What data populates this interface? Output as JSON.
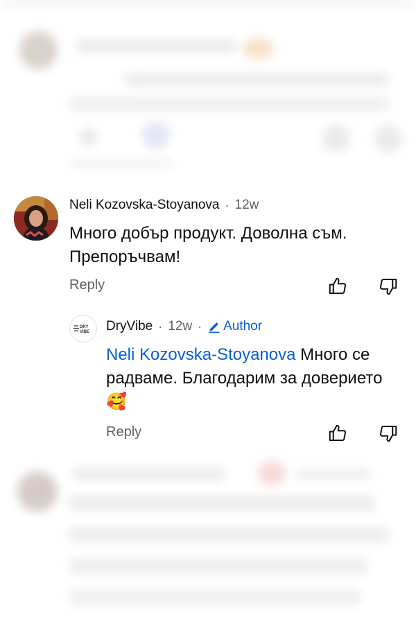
{
  "comment": {
    "author": "Neli Kozovska-Stoyanova",
    "time": "12w",
    "text": "Много добър продукт.  Доволна съм. Препоръчвам!",
    "reply_label": "Reply"
  },
  "reply": {
    "author": "DryVibe",
    "time": "12w",
    "badge_label": "Author",
    "mention": "Neli Kozovska-Stoyanova",
    "text": " Много се радваме. Благодарим за доверието",
    "emoji": "🥰",
    "reply_label": "Reply",
    "logo_text_top": "DRY",
    "logo_text_bottom": "VIBE"
  },
  "separator": "·",
  "colors": {
    "link": "#065fd4",
    "secondary_text": "#606060",
    "primary_text": "#0f0f0f"
  },
  "icons": [
    "thumb-up-icon",
    "thumb-down-icon",
    "pencil-icon"
  ]
}
